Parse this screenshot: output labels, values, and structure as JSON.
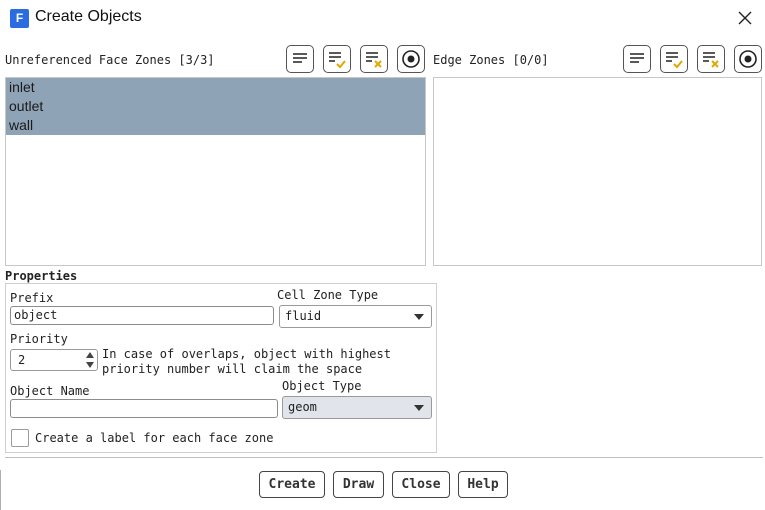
{
  "window": {
    "title": "Create Objects",
    "app_icon": "F"
  },
  "face_zones": {
    "label": "Unreferenced Face Zones [3/3]",
    "items": [
      "inlet",
      "outlet",
      "wall"
    ]
  },
  "edge_zones": {
    "label": "Edge Zones [0/0]",
    "items": []
  },
  "properties": {
    "title": "Properties",
    "prefix_label": "Prefix",
    "prefix_value": "object",
    "cell_zone_type_label": "Cell Zone Type",
    "cell_zone_type_value": "fluid",
    "priority_label": "Priority",
    "priority_value": "2",
    "priority_hint_line1": "In case of overlaps, object with highest",
    "priority_hint_line2": "priority number will claim the space",
    "object_name_label": "Object Name",
    "object_name_value": "",
    "object_type_label": "Object Type",
    "object_type_value": "geom",
    "create_label_checkbox": "Create a label for each face zone"
  },
  "buttons": {
    "create": "Create",
    "draw": "Draw",
    "close": "Close",
    "help": "Help"
  },
  "colors": {
    "selection": "#8fa3b7",
    "accent_icon": "#e0a800",
    "brand": "#2b6de0"
  }
}
